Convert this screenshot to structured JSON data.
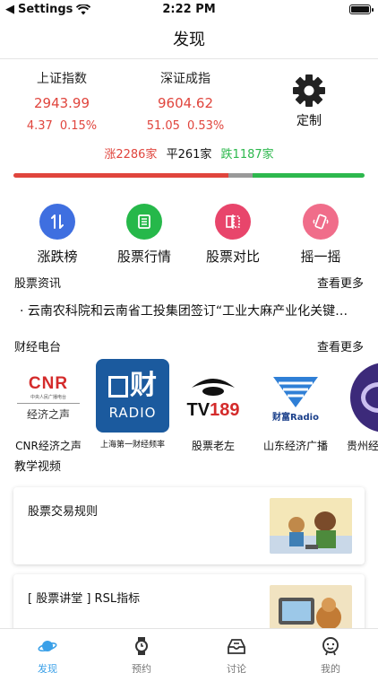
{
  "status_bar": {
    "carrier": "Settings",
    "time": "2:22 PM"
  },
  "nav": {
    "title": "发现"
  },
  "indices": [
    {
      "name": "上证指数",
      "value": "2943.99",
      "change": "4.37",
      "percent": "0.15%"
    },
    {
      "name": "深证成指",
      "value": "9604.62",
      "change": "51.05",
      "percent": "0.53%"
    }
  ],
  "custom": {
    "label": "定制",
    "icon": "gear-icon"
  },
  "breadth": {
    "up": "涨2286家",
    "flat": "平261家",
    "down": "跌1187家",
    "up_count": 2286,
    "flat_count": 261,
    "down_count": 1187
  },
  "colors": {
    "up": "#e0453d",
    "down": "#2db84d",
    "flat": "#999999",
    "accent": "#3aa0e8"
  },
  "shortcuts": [
    {
      "label": "涨跌榜",
      "icon": "up-down-arrows-icon",
      "color": "#3f6fe0"
    },
    {
      "label": "股票行情",
      "icon": "list-document-icon",
      "color": "#26b84a"
    },
    {
      "label": "股票对比",
      "icon": "compare-icon",
      "color": "#e8456b"
    },
    {
      "label": "摇一摇",
      "icon": "phone-shake-icon",
      "color": "#f06d8a"
    }
  ],
  "news": {
    "title": "股票资讯",
    "more": "查看更多",
    "item": "· 云南农科院和云南省工投集团签订“工业大麻产业化关键…"
  },
  "radio": {
    "title": "财经电台",
    "more": "查看更多",
    "stations": [
      {
        "name": "CNR经济之声",
        "logo_main": "CNR",
        "logo_sub": "中央人民广播电台",
        "logo_bottom": "经济之声"
      },
      {
        "name": "上海第一财经频率",
        "logo_main": "财",
        "logo_bottom": "RADIO"
      },
      {
        "name": "股票老左",
        "logo_main": "TV189"
      },
      {
        "name": "山东经济广播",
        "logo_main": "财富Radio"
      },
      {
        "name": "贵州经"
      }
    ]
  },
  "videos": {
    "title": "教学视频",
    "items": [
      {
        "title": "股票交易规则"
      },
      {
        "title": "[ 股票讲堂 ] RSL指标"
      }
    ]
  },
  "tabbar": [
    {
      "label": "发现",
      "icon": "planet-icon",
      "active": true
    },
    {
      "label": "预约",
      "icon": "watch-icon",
      "active": false
    },
    {
      "label": "讨论",
      "icon": "inbox-icon",
      "active": false
    },
    {
      "label": "我的",
      "icon": "face-icon",
      "active": false
    }
  ]
}
